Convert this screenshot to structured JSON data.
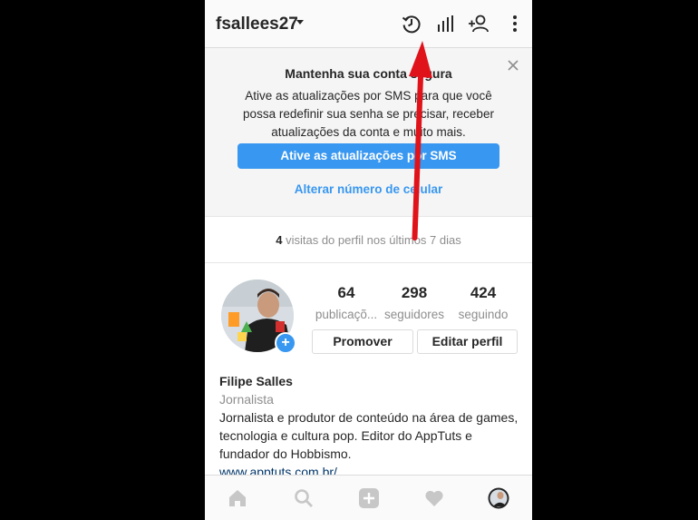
{
  "topbar": {
    "username": "fsallees27",
    "icons": [
      "history-icon",
      "insights-icon",
      "add-user-icon",
      "more-options-icon"
    ]
  },
  "banner": {
    "title": "Mantenha sua conta segura",
    "body": "Ative as atualizações por SMS para que você possa redefinir sua senha se precisar, receber atualizações da conta e muito mais.",
    "button_label": "Ative as atualizações por SMS",
    "link_label": "Alterar número de celular"
  },
  "visits": {
    "count": "4",
    "text": " visitas do perfil nos últimos 7 dias"
  },
  "profile": {
    "stats": [
      {
        "value": "64",
        "label": "publicaçõ..."
      },
      {
        "value": "298",
        "label": "seguidores"
      },
      {
        "value": "424",
        "label": "seguindo"
      }
    ],
    "promote_label": "Promover",
    "edit_label": "Editar perfil"
  },
  "bio": {
    "name": "Filipe Salles",
    "category": "Jornalista",
    "text": "Jornalista e produtor de conteúdo na área de games, tecnologia e cultura pop. Editor do AppTuts e fundador do Hobbismo.",
    "link": "www.apptuts.com.br/"
  },
  "bottomnav": {
    "items": [
      "home-icon",
      "search-icon",
      "new-post-icon",
      "activity-icon",
      "profile-avatar"
    ]
  },
  "colors": {
    "accent": "#3897f0",
    "annotation_arrow": "#e0121a"
  }
}
